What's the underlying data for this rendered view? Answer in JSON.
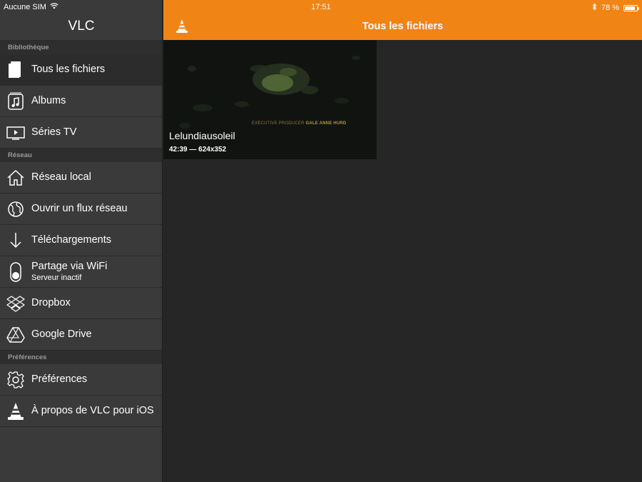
{
  "statusbar": {
    "carrier": "Aucune SIM",
    "time": "17:51",
    "battery": "78 %",
    "battery_level": 0.78
  },
  "sidebar": {
    "title": "VLC",
    "sections": [
      {
        "header": "Bibliothèque",
        "items": [
          {
            "label": "Tous les fichiers",
            "icon": "all-files-icon",
            "selected": true
          },
          {
            "label": "Albums",
            "icon": "music-note-icon"
          },
          {
            "label": "Séries TV",
            "icon": "tv-icon"
          }
        ]
      },
      {
        "header": "Réseau",
        "items": [
          {
            "label": "Réseau local",
            "icon": "home-icon"
          },
          {
            "label": "Ouvrir un flux réseau",
            "icon": "globe-icon"
          },
          {
            "label": "Téléchargements",
            "icon": "download-arrow-icon"
          },
          {
            "label": "Partage via WiFi",
            "sublabel": "Serveur inactif",
            "icon": "toggle-icon"
          },
          {
            "label": "Dropbox",
            "icon": "dropbox-icon"
          },
          {
            "label": "Google Drive",
            "icon": "google-drive-icon"
          }
        ]
      },
      {
        "header": "Préférences",
        "items": [
          {
            "label": "Préférences",
            "icon": "gear-icon"
          },
          {
            "label": "À propos de VLC pour iOS",
            "icon": "vlc-cone-icon"
          }
        ]
      }
    ]
  },
  "topbar": {
    "title": "Tous les fichiers",
    "menu_icon": "vlc-cone-menu-icon"
  },
  "files": [
    {
      "title": "Lelundiausoleil",
      "meta": "42:39 — 624x352",
      "credit_role": "EXECUTIVE PRODUCER",
      "credit_name": "GALE ANNE HURD"
    }
  ],
  "colors": {
    "accent": "#f08415",
    "sidebar_bg": "#3a3a3a",
    "content_bg": "#262626"
  }
}
